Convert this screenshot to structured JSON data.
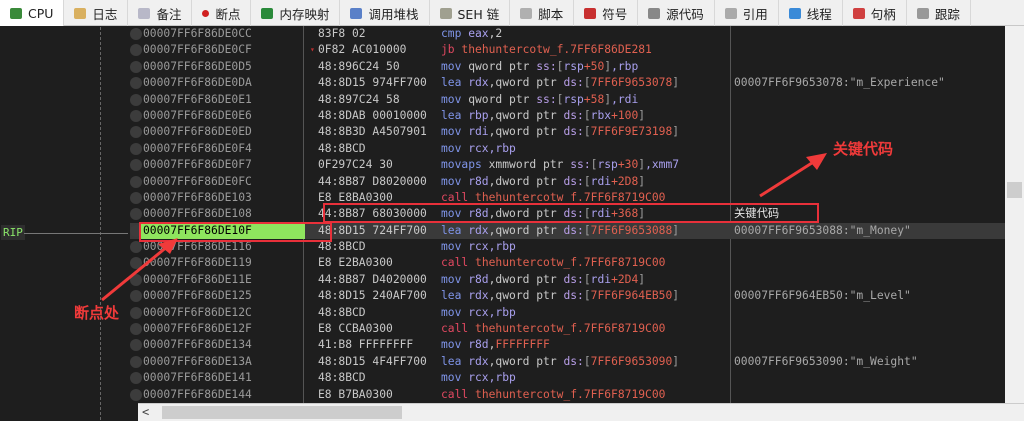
{
  "tabs": [
    {
      "label": "CPU",
      "icon": "cpu-icon",
      "color": "#3a8a3a",
      "active": true
    },
    {
      "label": "日志",
      "icon": "log-icon",
      "color": "#d9b060"
    },
    {
      "label": "备注",
      "icon": "notes-icon",
      "color": "#b8b8c8"
    },
    {
      "label": "断点",
      "icon": "breakpoint-icon",
      "color": "#d02020"
    },
    {
      "label": "内存映射",
      "icon": "memory-map-icon",
      "color": "#2a8a3a"
    },
    {
      "label": "调用堆栈",
      "icon": "call-stack-icon",
      "color": "#5a80c8"
    },
    {
      "label": "SEH 链",
      "icon": "seh-chain-icon",
      "color": "#a0a090"
    },
    {
      "label": "脚本",
      "icon": "script-icon",
      "color": "#b0b0b0"
    },
    {
      "label": "符号",
      "icon": "symbol-icon",
      "color": "#c83030"
    },
    {
      "label": "源代码",
      "icon": "source-code-icon",
      "color": "#888888"
    },
    {
      "label": "引用",
      "icon": "references-icon",
      "color": "#aaaaaa"
    },
    {
      "label": "线程",
      "icon": "threads-icon",
      "color": "#3a8ad8"
    },
    {
      "label": "句柄",
      "icon": "handles-icon",
      "color": "#d04040"
    },
    {
      "label": "跟踪",
      "icon": "trace-icon",
      "color": "#999999"
    }
  ],
  "rip_label": "RIP",
  "rows": [
    {
      "addr": "00007FF6F86DE0CC",
      "bytes": "83F8 02",
      "dis": [
        [
          "cmp",
          "mn"
        ],
        [
          " eax",
          "rg"
        ],
        [
          ",2",
          "pl"
        ]
      ],
      "cmt": ""
    },
    {
      "addr": "00007FF6F86DE0CF",
      "bytes": "0F82 AC010000",
      "jump": true,
      "dis": [
        [
          "jb",
          "br"
        ],
        [
          " thehuntercotw_f.7FF6F86DE281",
          "nm"
        ]
      ],
      "cmt": ""
    },
    {
      "addr": "00007FF6F86DE0D5",
      "bytes": "48:896C24 50",
      "dis": [
        [
          "mov",
          "mn"
        ],
        [
          " qword ptr ",
          "sz"
        ],
        [
          "ss:",
          "sg"
        ],
        [
          "[",
          "bk"
        ],
        [
          "rsp",
          "rg"
        ],
        [
          "+50",
          "nm"
        ],
        [
          "]",
          "bk"
        ],
        [
          ",rbp",
          "rg"
        ]
      ],
      "cmt": ""
    },
    {
      "addr": "00007FF6F86DE0DA",
      "bytes": "48:8D15 974FF700",
      "dis": [
        [
          "lea",
          "mn"
        ],
        [
          " rdx",
          "rg"
        ],
        [
          ",qword ptr ",
          "sz"
        ],
        [
          "ds:",
          "sg"
        ],
        [
          "[",
          "bk"
        ],
        [
          "7FF6F9653078",
          "nm"
        ],
        [
          "]",
          "bk"
        ]
      ],
      "cmt": "00007FF6F9653078:\"m_Experience\""
    },
    {
      "addr": "00007FF6F86DE0E1",
      "bytes": "48:897C24 58",
      "dis": [
        [
          "mov",
          "mn"
        ],
        [
          " qword ptr ",
          "sz"
        ],
        [
          "ss:",
          "sg"
        ],
        [
          "[",
          "bk"
        ],
        [
          "rsp",
          "rg"
        ],
        [
          "+58",
          "nm"
        ],
        [
          "]",
          "bk"
        ],
        [
          ",rdi",
          "rg"
        ]
      ],
      "cmt": ""
    },
    {
      "addr": "00007FF6F86DE0E6",
      "bytes": "48:8DAB 00010000",
      "dis": [
        [
          "lea",
          "mn"
        ],
        [
          " rbp",
          "rg"
        ],
        [
          ",qword ptr ",
          "sz"
        ],
        [
          "ds:",
          "sg"
        ],
        [
          "[",
          "bk"
        ],
        [
          "rbx",
          "rg"
        ],
        [
          "+100",
          "nm"
        ],
        [
          "]",
          "bk"
        ]
      ],
      "cmt": ""
    },
    {
      "addr": "00007FF6F86DE0ED",
      "bytes": "48:8B3D A4507901",
      "dis": [
        [
          "mov",
          "mn"
        ],
        [
          " rdi",
          "rg"
        ],
        [
          ",qword ptr ",
          "sz"
        ],
        [
          "ds:",
          "sg"
        ],
        [
          "[",
          "bk"
        ],
        [
          "7FF6F9E73198",
          "nm"
        ],
        [
          "]",
          "bk"
        ]
      ],
      "cmt": ""
    },
    {
      "addr": "00007FF6F86DE0F4",
      "bytes": "48:8BCD",
      "dis": [
        [
          "mov",
          "mn"
        ],
        [
          " rcx",
          "rg"
        ],
        [
          ",rbp",
          "rg"
        ]
      ],
      "cmt": ""
    },
    {
      "addr": "00007FF6F86DE0F7",
      "bytes": "0F297C24 30",
      "dis": [
        [
          "movaps",
          "mn"
        ],
        [
          " xmmword ptr ",
          "sz"
        ],
        [
          "ss:",
          "sg"
        ],
        [
          "[",
          "bk"
        ],
        [
          "rsp",
          "rg"
        ],
        [
          "+30",
          "nm"
        ],
        [
          "]",
          "bk"
        ],
        [
          ",xmm7",
          "rg"
        ]
      ],
      "cmt": ""
    },
    {
      "addr": "00007FF6F86DE0FC",
      "bytes": "44:8B87 D8020000",
      "dis": [
        [
          "mov",
          "mn"
        ],
        [
          " r8d",
          "rg"
        ],
        [
          ",dword ptr ",
          "sz"
        ],
        [
          "ds:",
          "sg"
        ],
        [
          "[",
          "bk"
        ],
        [
          "rdi",
          "rg"
        ],
        [
          "+2D8",
          "nm"
        ],
        [
          "]",
          "bk"
        ]
      ],
      "cmt": ""
    },
    {
      "addr": "00007FF6F86DE103",
      "bytes": "E8 E8BA0300",
      "dis": [
        [
          "call",
          "br"
        ],
        [
          " thehuntercotw_f.7FF6F8719C00",
          "nm"
        ]
      ],
      "cmt": ""
    },
    {
      "addr": "00007FF6F86DE108",
      "bytes": "44:8B87 68030000",
      "dis": [
        [
          "mov",
          "mn"
        ],
        [
          " r8d",
          "rg"
        ],
        [
          ",dword ptr ",
          "sz"
        ],
        [
          "ds:",
          "sg"
        ],
        [
          "[",
          "bk"
        ],
        [
          "rdi",
          "rg"
        ],
        [
          "+368",
          "nm"
        ],
        [
          "]",
          "bk"
        ]
      ],
      "cmt": "关键代码",
      "cmt_white": true
    },
    {
      "addr": "00007FF6F86DE10F",
      "bytes": "48:8D15 724FF700",
      "current": true,
      "dis": [
        [
          "lea",
          "mn"
        ],
        [
          " rdx",
          "rg"
        ],
        [
          ",qword ptr ",
          "sz"
        ],
        [
          "ds:",
          "sg"
        ],
        [
          "[",
          "bk"
        ],
        [
          "7FF6F9653088",
          "nm"
        ],
        [
          "]",
          "bk"
        ]
      ],
      "cmt": "00007FF6F9653088:\"m_Money\""
    },
    {
      "addr": "00007FF6F86DE116",
      "bytes": "48:8BCD",
      "dis": [
        [
          "mov",
          "mn"
        ],
        [
          " rcx",
          "rg"
        ],
        [
          ",rbp",
          "rg"
        ]
      ],
      "cmt": ""
    },
    {
      "addr": "00007FF6F86DE119",
      "bytes": "E8 E2BA0300",
      "dis": [
        [
          "call",
          "br"
        ],
        [
          " thehuntercotw_f.7FF6F8719C00",
          "nm"
        ]
      ],
      "cmt": ""
    },
    {
      "addr": "00007FF6F86DE11E",
      "bytes": "44:8B87 D4020000",
      "dis": [
        [
          "mov",
          "mn"
        ],
        [
          " r8d",
          "rg"
        ],
        [
          ",dword ptr ",
          "sz"
        ],
        [
          "ds:",
          "sg"
        ],
        [
          "[",
          "bk"
        ],
        [
          "rdi",
          "rg"
        ],
        [
          "+2D4",
          "nm"
        ],
        [
          "]",
          "bk"
        ]
      ],
      "cmt": ""
    },
    {
      "addr": "00007FF6F86DE125",
      "bytes": "48:8D15 240AF700",
      "dis": [
        [
          "lea",
          "mn"
        ],
        [
          " rdx",
          "rg"
        ],
        [
          ",qword ptr ",
          "sz"
        ],
        [
          "ds:",
          "sg"
        ],
        [
          "[",
          "bk"
        ],
        [
          "7FF6F964EB50",
          "nm"
        ],
        [
          "]",
          "bk"
        ]
      ],
      "cmt": "00007FF6F964EB50:\"m_Level\""
    },
    {
      "addr": "00007FF6F86DE12C",
      "bytes": "48:8BCD",
      "dis": [
        [
          "mov",
          "mn"
        ],
        [
          " rcx",
          "rg"
        ],
        [
          ",rbp",
          "rg"
        ]
      ],
      "cmt": ""
    },
    {
      "addr": "00007FF6F86DE12F",
      "bytes": "E8 CCBA0300",
      "dis": [
        [
          "call",
          "br"
        ],
        [
          " thehuntercotw_f.7FF6F8719C00",
          "nm"
        ]
      ],
      "cmt": ""
    },
    {
      "addr": "00007FF6F86DE134",
      "bytes": "41:B8 FFFFFFFF",
      "dis": [
        [
          "mov",
          "mn"
        ],
        [
          " r8d",
          "rg"
        ],
        [
          ",",
          "pl"
        ],
        [
          "FFFFFFFF",
          "nm"
        ]
      ],
      "cmt": ""
    },
    {
      "addr": "00007FF6F86DE13A",
      "bytes": "48:8D15 4F4FF700",
      "dis": [
        [
          "lea",
          "mn"
        ],
        [
          " rdx",
          "rg"
        ],
        [
          ",qword ptr ",
          "sz"
        ],
        [
          "ds:",
          "sg"
        ],
        [
          "[",
          "bk"
        ],
        [
          "7FF6F9653090",
          "nm"
        ],
        [
          "]",
          "bk"
        ]
      ],
      "cmt": "00007FF6F9653090:\"m_Weight\""
    },
    {
      "addr": "00007FF6F86DE141",
      "bytes": "48:8BCD",
      "dis": [
        [
          "mov",
          "mn"
        ],
        [
          " rcx",
          "rg"
        ],
        [
          ",rbp",
          "rg"
        ]
      ],
      "cmt": ""
    },
    {
      "addr": "00007FF6F86DE144",
      "bytes": "E8 B7BA0300",
      "dis": [
        [
          "call",
          "br"
        ],
        [
          " thehuntercotw_f.7FF6F8719C00",
          "nm"
        ]
      ],
      "cmt": ""
    }
  ],
  "annotations": {
    "breakpoint": "断点处",
    "key_code": "关键代码"
  },
  "scroll": {
    "left_arrow": "<"
  }
}
